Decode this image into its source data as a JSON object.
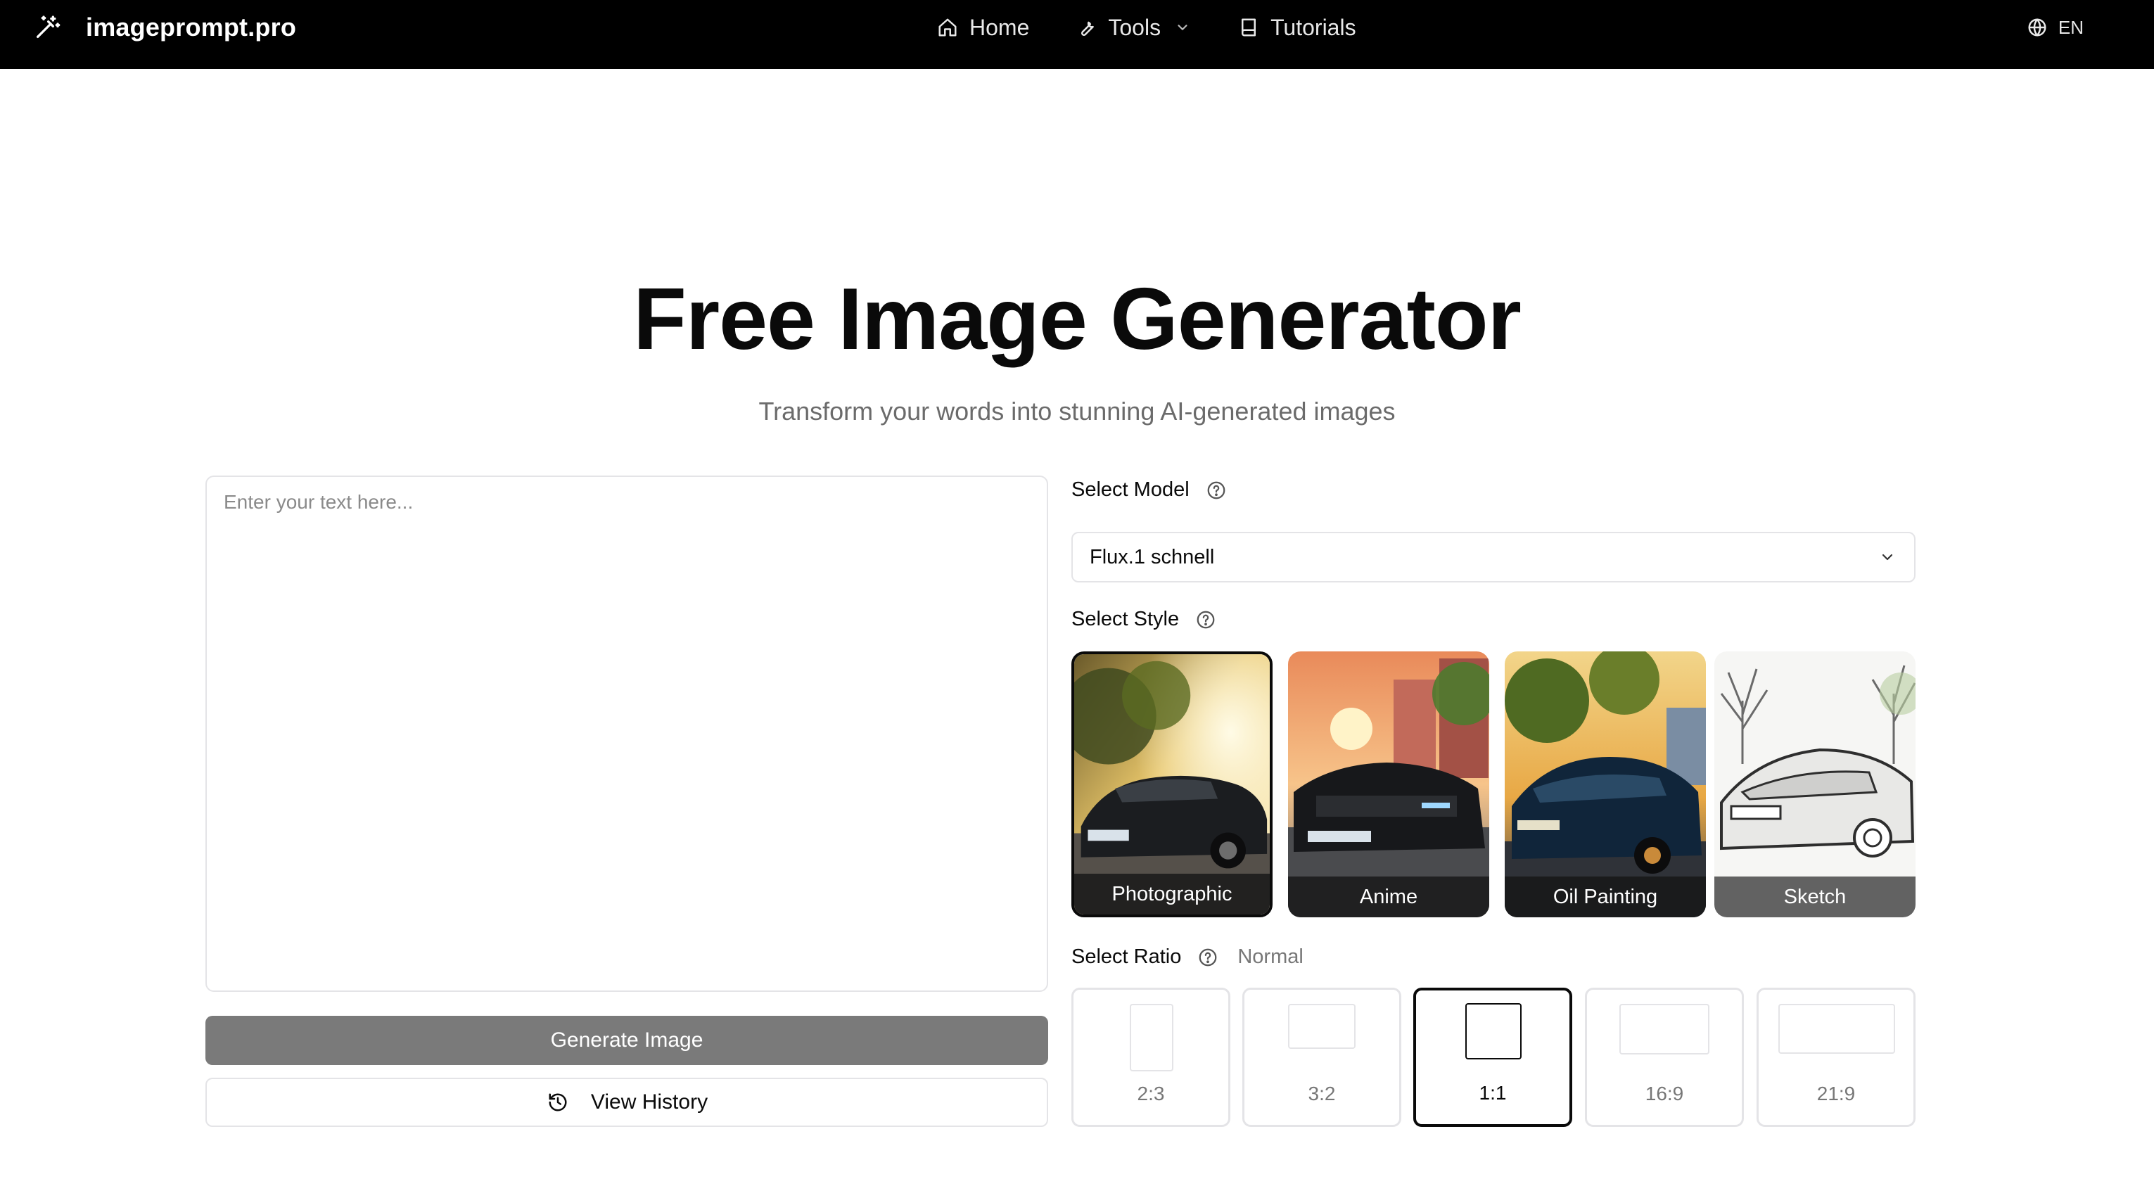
{
  "header": {
    "brand": "imageprompt.pro",
    "nav": [
      {
        "label": "Home",
        "icon": "home-icon"
      },
      {
        "label": "Tools",
        "icon": "wrench-icon"
      },
      {
        "label": "Tutorials",
        "icon": "book-icon"
      }
    ],
    "language": "EN"
  },
  "hero": {
    "title": "Free Image Generator",
    "subtitle": "Transform your words into stunning AI-generated images"
  },
  "prompt": {
    "placeholder": "Enter your text here...",
    "value": ""
  },
  "actions": {
    "generate_label": "Generate Image",
    "history_label": "View History"
  },
  "model": {
    "label": "Select Model",
    "selected": "Flux.1 schnell"
  },
  "style": {
    "label": "Select Style",
    "options": [
      {
        "label": "Photographic",
        "selected": true
      },
      {
        "label": "Anime",
        "selected": false
      },
      {
        "label": "Oil Painting",
        "selected": false
      },
      {
        "label": "Sketch",
        "selected": false
      }
    ]
  },
  "ratio": {
    "label": "Select Ratio",
    "mode": "Normal",
    "options": [
      {
        "label": "2:3",
        "selected": false
      },
      {
        "label": "3:2",
        "selected": false
      },
      {
        "label": "1:1",
        "selected": true
      },
      {
        "label": "16:9",
        "selected": false
      },
      {
        "label": "21:9",
        "selected": false
      }
    ]
  },
  "colors": {
    "navbar_bg": "#000000",
    "accent": "#0a0a0a",
    "button_disabled": "#7a7a7a",
    "border": "#e4e4e7",
    "muted_text": "#6b6b6b"
  }
}
